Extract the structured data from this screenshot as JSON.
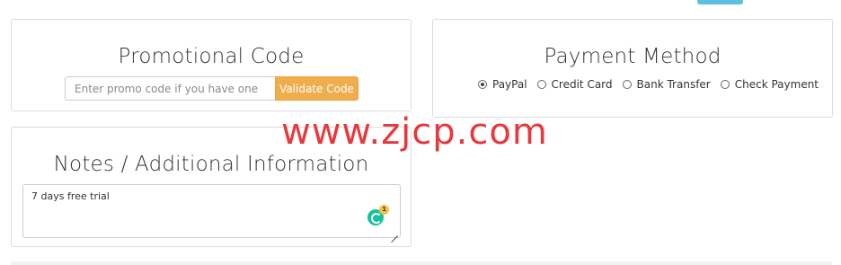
{
  "promo": {
    "title": "Promotional Code",
    "input_placeholder": "Enter promo code if you have one",
    "button_label": "Validate Code"
  },
  "payment": {
    "title": "Payment Method",
    "options": [
      {
        "label": "PayPal",
        "checked": true
      },
      {
        "label": "Credit Card",
        "checked": false
      },
      {
        "label": "Bank Transfer",
        "checked": false
      },
      {
        "label": "Check Payment",
        "checked": false
      }
    ]
  },
  "notes": {
    "title": "Notes / Additional Information",
    "value": "7 days free trial",
    "grammar_count": "1"
  },
  "watermark": "www.zjcp.com",
  "colors": {
    "validate_button": "#f0ad4e",
    "top_button": "#5bc0de",
    "watermark": "#e8383d",
    "grammar": "#15c39a"
  }
}
